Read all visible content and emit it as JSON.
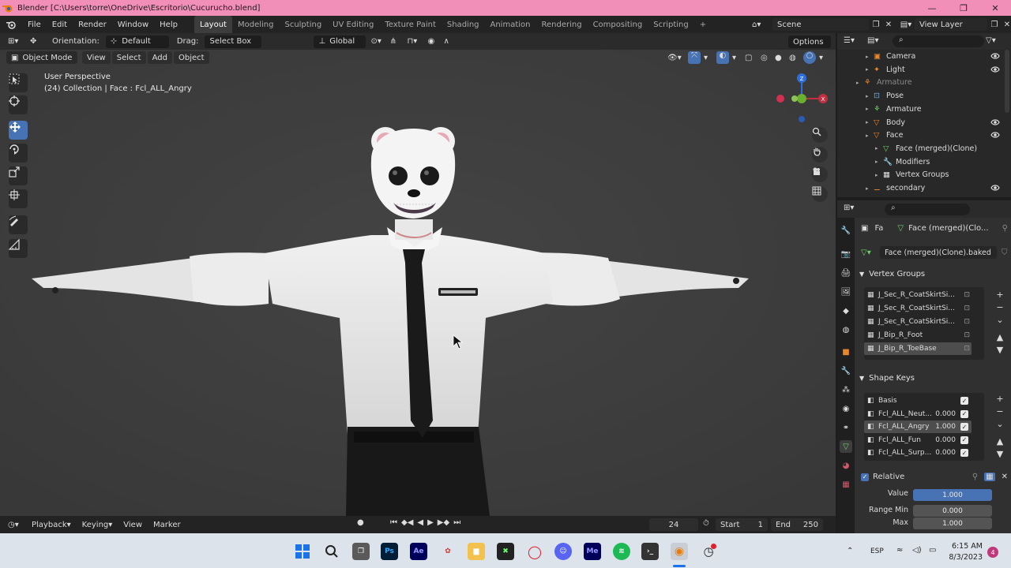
{
  "window": {
    "title": "Blender [C:\\Users\\torre\\OneDrive\\Escritorio\\Cucurucho.blend]"
  },
  "menus": [
    "File",
    "Edit",
    "Render",
    "Window",
    "Help"
  ],
  "workspaces": [
    "Layout",
    "Modeling",
    "Sculpting",
    "UV Editing",
    "Texture Paint",
    "Shading",
    "Animation",
    "Rendering",
    "Compositing",
    "Scripting"
  ],
  "workspace_add": "+",
  "scene": {
    "name": "Scene",
    "view_layer": "View Layer"
  },
  "viewport_header": {
    "orientation_label": "Orientation:",
    "orientation_value": "Default",
    "drag_label": "Drag:",
    "drag_value": "Select Box",
    "transform_space": "Global",
    "options": "Options"
  },
  "viewport_header2": {
    "mode": "Object Mode",
    "view": "View",
    "select": "Select",
    "add": "Add",
    "object": "Object"
  },
  "viewport": {
    "perspective": "User Perspective",
    "collection_info": "(24) Collection | Face : Fcl_ALL_Angry"
  },
  "timeline": {
    "playback": "Playback",
    "keying": "Keying",
    "view": "View",
    "marker": "Marker",
    "current_frame": "24",
    "start_label": "Start",
    "start": "1",
    "end_label": "End",
    "end": "250"
  },
  "outliner": [
    {
      "name": "Camera",
      "indent": 1
    },
    {
      "name": "Light",
      "indent": 1
    },
    {
      "name": "Armature",
      "indent": 0,
      "dim": true
    },
    {
      "name": "Pose",
      "indent": 1
    },
    {
      "name": "Armature",
      "indent": 1
    },
    {
      "name": "Body",
      "indent": 1
    },
    {
      "name": "Face",
      "indent": 1
    },
    {
      "name": "Face (merged)(Clone)",
      "indent": 2
    },
    {
      "name": "Modifiers",
      "indent": 2
    },
    {
      "name": "Vertex Groups",
      "indent": 2
    },
    {
      "name": "secondary",
      "indent": 1
    }
  ],
  "properties": {
    "breadcrumb_short": "Fa",
    "breadcrumb_mesh": "Face (merged)(Clo...",
    "mesh_name": "Face (merged)(Clone).baked",
    "vertex_groups_title": "Vertex Groups",
    "vertex_groups": [
      "J_Sec_R_CoatSkirtSi...",
      "J_Sec_R_CoatSkirtSi...",
      "J_Sec_R_CoatSkirtSi...",
      "J_Bip_R_Foot",
      "J_Bip_R_ToeBase"
    ],
    "shape_keys_title": "Shape Keys",
    "shape_keys": [
      {
        "name": "Basis",
        "value": ""
      },
      {
        "name": "Fcl_ALL_Neut...",
        "value": "0.000"
      },
      {
        "name": "Fcl_ALL_Angry",
        "value": "1.000"
      },
      {
        "name": "Fcl_ALL_Fun",
        "value": "0.000"
      },
      {
        "name": "Fcl_ALL_Surp...",
        "value": "0.000"
      }
    ],
    "relative_label": "Relative",
    "value_label": "Value",
    "value": "1.000",
    "range_min_label": "Range Min",
    "range_min": "0.000",
    "max_label": "Max",
    "max": "1.000"
  },
  "taskbar": {
    "lang": "ESP",
    "time": "6:15 AM",
    "date": "8/3/2023",
    "notifications": "4",
    "apps": [
      "Ps",
      "Ae",
      "Me"
    ]
  },
  "colors": {
    "titlebar": "#f28fb8",
    "accent": "#4772b3",
    "viewport": "#3d3d3d"
  }
}
